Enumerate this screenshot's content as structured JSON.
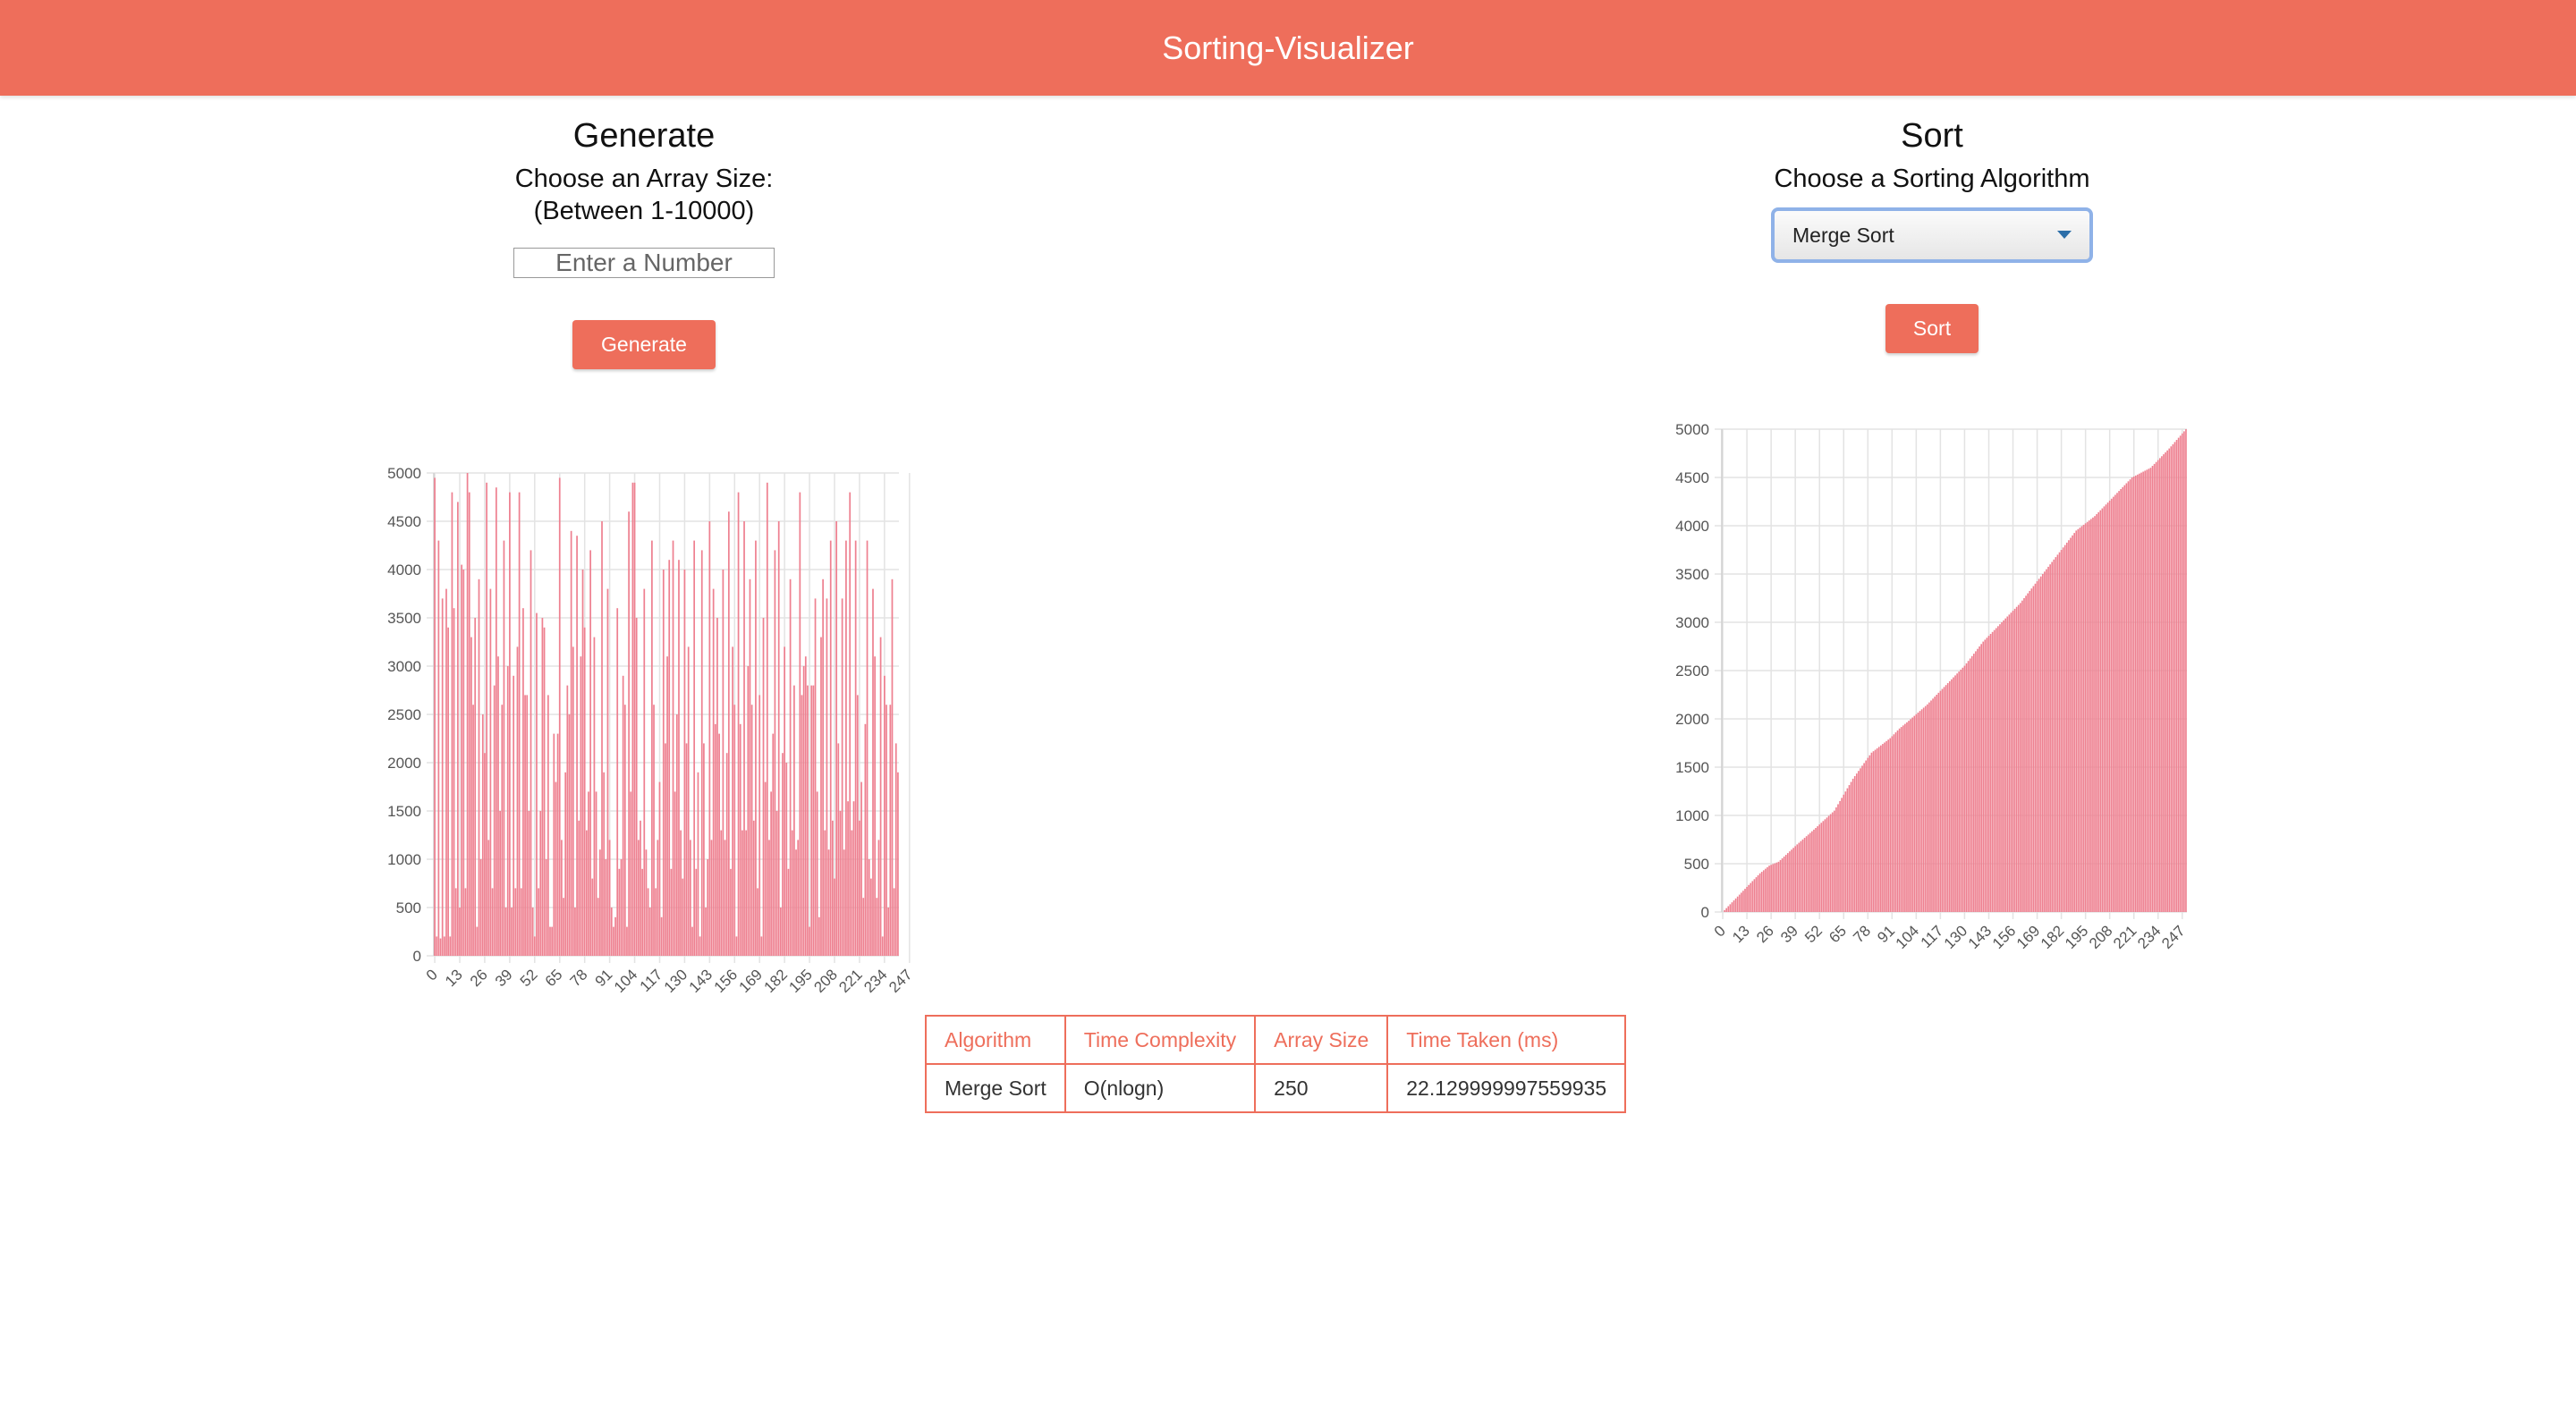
{
  "app": {
    "title": "Sorting-Visualizer"
  },
  "colors": {
    "accent": "#ee6e5b",
    "bar": "#ee8090",
    "grid": "#e3e3e3"
  },
  "generate": {
    "heading": "Generate",
    "label_line1": "Choose an Array Size:",
    "label_line2": "(Between 1-10000)",
    "input_placeholder": "Enter a Number",
    "input_value": "",
    "button_label": "Generate"
  },
  "sort": {
    "heading": "Sort",
    "label": "Choose a Sorting Algorithm",
    "selected_algorithm": "Merge Sort",
    "button_label": "Sort"
  },
  "chart_data": [
    {
      "type": "bar",
      "title": "",
      "n": 250,
      "x_tick_labels": [
        "0",
        "13",
        "26",
        "39",
        "52",
        "65",
        "78",
        "91",
        "104",
        "117",
        "130",
        "143",
        "156",
        "169",
        "182",
        "195",
        "208",
        "221",
        "234",
        "247"
      ],
      "ylim": [
        0,
        5000
      ],
      "y_ticks": [
        0,
        500,
        1000,
        1500,
        2000,
        2500,
        3000,
        3500,
        4000,
        4500,
        5000
      ],
      "grid": true,
      "legend": "none",
      "values": [
        4950,
        200,
        4300,
        180,
        3700,
        200,
        3800,
        3400,
        200,
        4800,
        3600,
        700,
        4700,
        500,
        4050,
        4000,
        700,
        5000,
        4800,
        3300,
        2600,
        3500,
        300,
        3900,
        1000,
        2500,
        2100,
        4900,
        1200,
        3800,
        700,
        2800,
        4850,
        3100,
        1500,
        2600,
        4300,
        500,
        3000,
        4800,
        500,
        2900,
        700,
        3200,
        4800,
        700,
        3600,
        2700,
        2700,
        1500,
        4200,
        500,
        200,
        3550,
        700,
        1500,
        3500,
        3400,
        1000,
        2700,
        300,
        300,
        2300,
        1800,
        2300,
        4950,
        1200,
        600,
        1900,
        2800,
        2500,
        4400,
        3200,
        500,
        4350,
        1400,
        3100,
        4000,
        3400,
        1300,
        1700,
        4200,
        800,
        3300,
        1700,
        600,
        1100,
        4500,
        1900,
        1000,
        3800,
        1200,
        500,
        300,
        400,
        3600,
        900,
        1000,
        2900,
        2600,
        300,
        4600,
        1700,
        4900,
        4900,
        3500,
        1200,
        1400,
        900,
        3800,
        1100,
        700,
        500,
        4300,
        2600,
        700,
        1200,
        1800,
        400,
        4000,
        2200,
        3100,
        4100,
        900,
        4300,
        1700,
        2500,
        4100,
        1300,
        800,
        4000,
        2200,
        3200,
        1200,
        300,
        4300,
        900,
        1900,
        200,
        4200,
        2200,
        500,
        1000,
        4500,
        1200,
        3800,
        2400,
        3500,
        2300,
        1300,
        4000,
        1200,
        2100,
        4600,
        900,
        3200,
        2600,
        200,
        4800,
        2400,
        1300,
        4500,
        1300,
        3000,
        3900,
        2600,
        1400,
        4300,
        700,
        2700,
        200,
        3500,
        1800,
        4900,
        1200,
        1700,
        2300,
        4200,
        1500,
        4500,
        500,
        2100,
        3200,
        2000,
        900,
        3900,
        1300,
        2800,
        1100,
        1200,
        4800,
        2700,
        3000,
        3100,
        2800,
        300,
        2800,
        2800,
        3700,
        1700,
        400,
        3300,
        3900,
        1300,
        3700,
        1100,
        4300,
        1400,
        800,
        4500,
        2200,
        1500,
        3700,
        1100,
        4300,
        1600,
        4800,
        1300,
        1600,
        4300,
        2700,
        1400,
        1800,
        600,
        2400,
        4300,
        1000,
        800,
        3800,
        3100,
        600,
        1200,
        3300,
        200,
        2900,
        2600,
        500,
        2600,
        3900,
        700,
        2200,
        1900
      ]
    },
    {
      "type": "bar",
      "title": "",
      "n": 250,
      "x_tick_labels": [
        "0",
        "13",
        "26",
        "39",
        "52",
        "65",
        "78",
        "91",
        "104",
        "117",
        "130",
        "143",
        "156",
        "169",
        "182",
        "195",
        "208",
        "221",
        "234",
        "247"
      ],
      "ylim": [
        0,
        5000
      ],
      "y_ticks": [
        0,
        500,
        1000,
        1500,
        2000,
        2500,
        3000,
        3500,
        4000,
        4500,
        5000
      ],
      "grid": true,
      "legend": "none",
      "sorted": true,
      "anchors": [
        [
          0,
          0
        ],
        [
          10,
          200
        ],
        [
          20,
          400
        ],
        [
          25,
          480
        ],
        [
          30,
          520
        ],
        [
          40,
          700
        ],
        [
          50,
          870
        ],
        [
          60,
          1050
        ],
        [
          70,
          1380
        ],
        [
          80,
          1650
        ],
        [
          90,
          1800
        ],
        [
          95,
          1900
        ],
        [
          100,
          1980
        ],
        [
          110,
          2150
        ],
        [
          120,
          2350
        ],
        [
          130,
          2550
        ],
        [
          140,
          2800
        ],
        [
          150,
          3000
        ],
        [
          160,
          3200
        ],
        [
          170,
          3450
        ],
        [
          180,
          3700
        ],
        [
          190,
          3950
        ],
        [
          200,
          4100
        ],
        [
          210,
          4300
        ],
        [
          220,
          4500
        ],
        [
          230,
          4600
        ],
        [
          235,
          4700
        ],
        [
          240,
          4800
        ],
        [
          249,
          5000
        ]
      ]
    }
  ],
  "results": {
    "headers": [
      "Algorithm",
      "Time Complexity",
      "Array Size",
      "Time Taken (ms)"
    ],
    "row": {
      "algorithm": "Merge Sort",
      "complexity": "O(nlogn)",
      "size": "250",
      "time": "22.129999997559935"
    }
  }
}
